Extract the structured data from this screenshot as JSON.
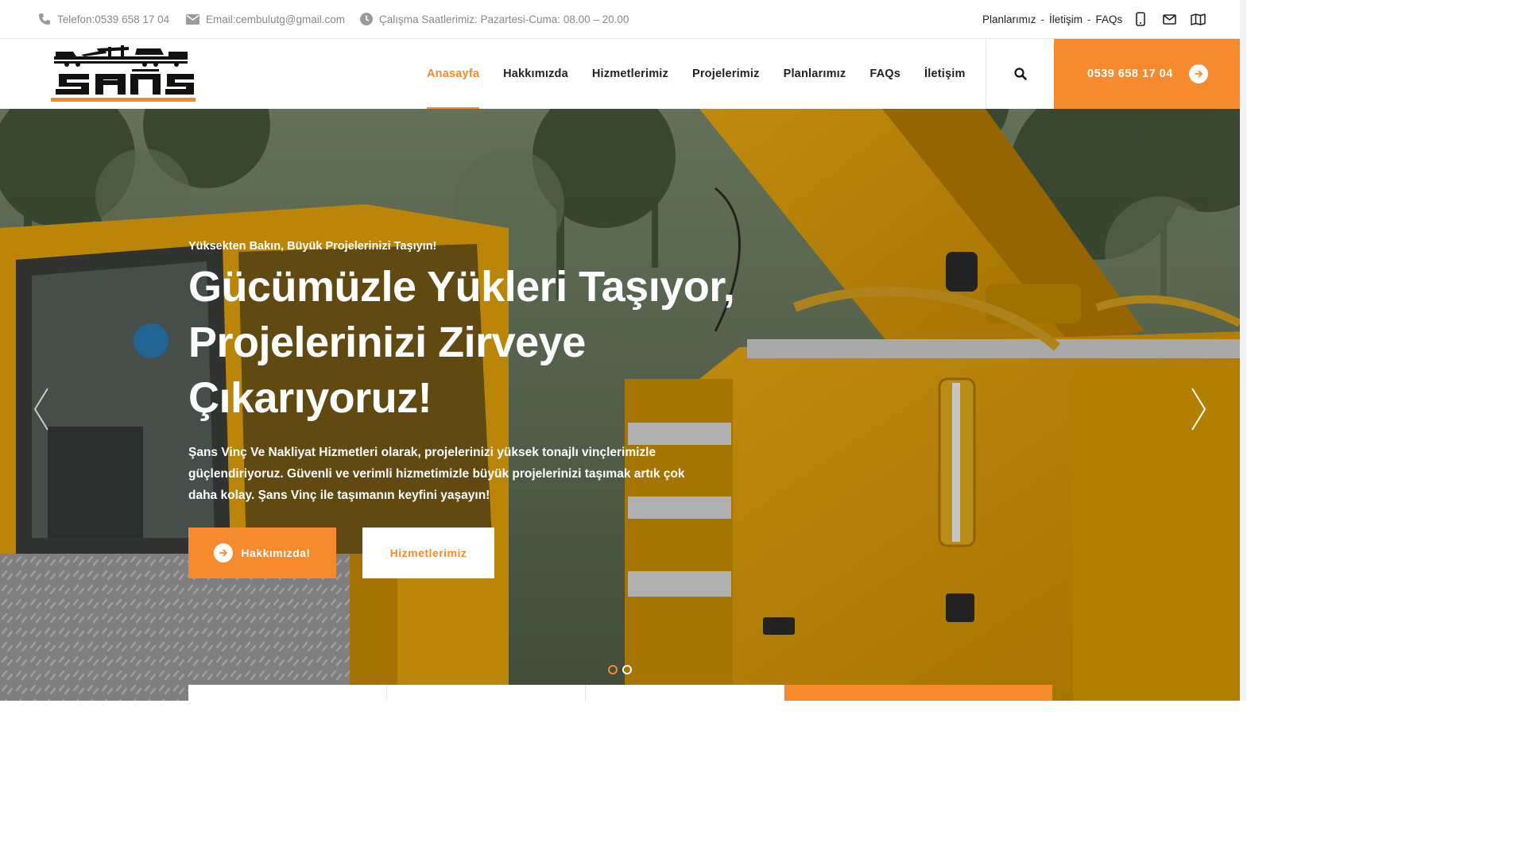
{
  "topbar": {
    "phone": "Telefon:0539 658 17 04",
    "email": "Email:cembulutg@gmail.com",
    "hours": "Çalışma Saatlerimiz: Pazartesi-Cuma: 08.00 – 20.00",
    "links": [
      "Planlarımız",
      "İletişim",
      "FAQs"
    ],
    "separator": "-"
  },
  "logo": {
    "text": "şans"
  },
  "nav": {
    "items": [
      {
        "label": "Anasayfa",
        "active": true
      },
      {
        "label": "Hakkımızda",
        "active": false
      },
      {
        "label": "Hizmetlerimiz",
        "active": false
      },
      {
        "label": "Projelerimiz",
        "active": false
      },
      {
        "label": "Planlarımız",
        "active": false
      },
      {
        "label": "FAQs",
        "active": false
      },
      {
        "label": "İletişim",
        "active": false
      }
    ],
    "cta_phone": "0539 658 17 04"
  },
  "hero": {
    "kicker": "Yüksekten Bakın, Büyük Projelerinizi Taşıyın!",
    "headline_line1": "Gücümüzle Yükleri Taşıyor,",
    "headline_line2": "Projelerinizi Zirveye",
    "headline_line3": "Çıkarıyoruz!",
    "lead": "Şans Vinç Ve Nakliyat Hizmetleri olarak, projelerinizi yüksek tonajlı vinçlerimizle güçlendiriyoruz. Güvenli ve verimli hizmetimizle büyük projelerinizi taşımak artık çok daha kolay. Şans Vinç ile taşımanın keyfini yaşayın!",
    "primary_button": "Hakkımızda!",
    "secondary_button": "Hizmetlerimiz",
    "slides_total": 2,
    "active_slide": 1
  },
  "colors": {
    "accent": "#f58a2e",
    "crane_yellow": "#e8a800",
    "text_dark": "#222222"
  }
}
